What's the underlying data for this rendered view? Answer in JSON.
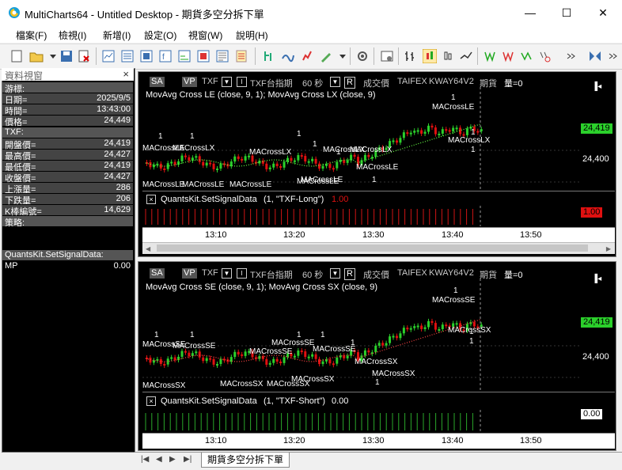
{
  "window": {
    "title": "MultiCharts64 - Untitled Desktop - 期貨多空分拆下單",
    "minimize": "—",
    "maximize": "☐",
    "close": "✕"
  },
  "menu": [
    "檔案(F)",
    "檢視(I)",
    "新增(I)",
    "設定(O)",
    "視窗(W)",
    "說明(H)"
  ],
  "data_window": {
    "title": "資料視窗",
    "close": "×",
    "rows": [
      {
        "label": "游標:",
        "value": ""
      },
      {
        "label": "日期=",
        "value": "2025/9/5"
      },
      {
        "label": "時間=",
        "value": "13:43:00"
      },
      {
        "label": "價格=",
        "value": "24,449"
      },
      {
        "label": "TXF:",
        "value": ""
      },
      {
        "label": "開盤價=",
        "value": "24,419"
      },
      {
        "label": "最高價=",
        "value": "24,427"
      },
      {
        "label": "最低價=",
        "value": "24,419"
      },
      {
        "label": "收盤價=",
        "value": "24,427"
      },
      {
        "label": "上漲量=",
        "value": "286"
      },
      {
        "label": "下跌量=",
        "value": "206"
      },
      {
        "label": "K棒編號=",
        "value": "14,629"
      },
      {
        "label": "策略:",
        "value": ""
      }
    ],
    "section2_title": "QuantsKit.SetSignalData:",
    "section2_rows": [
      {
        "label": "MP",
        "value": "0.00"
      }
    ]
  },
  "chart1": {
    "header": {
      "sa": "SA",
      "vp": "VP",
      "symbol": "TXF",
      "ticker_desc": "TXF台指期",
      "interval": "60 秒",
      "r_btn": "R",
      "mode": "成交價",
      "exchange": "TAIFEX",
      "feed": "KWAY64V2",
      "type": "期貨",
      "volume": "量=0"
    },
    "strategy_line": "MovAvg Cross LE (close,  9,  1); MovAvg Cross LX (close,  9)",
    "price_last": "24,419",
    "price_level": "24,400",
    "indicator_label": "QuantsKit.SetSignalData",
    "indicator_params": "(1,  \"TXF-Long\")",
    "indicator_value": "1.00",
    "indicator_tag": "1.00",
    "signals": [
      {
        "label": "MACrossLE",
        "count": "1"
      },
      {
        "label": "MACrossLX",
        "count": "1"
      }
    ],
    "signal_texts": [
      "1",
      "MACrossLE",
      "1",
      "MACrossLX",
      "1",
      "MACrossLX",
      "1",
      "MACrossLX",
      "1",
      "MACrossLX",
      "MACrossLE",
      "MACrossLE",
      "MACrossLE",
      "MACrossLE",
      "1",
      "MACrossLE",
      "1",
      "MACrossLX",
      "1",
      "MACrossLE",
      "1",
      "MACrossLE"
    ]
  },
  "chart2": {
    "header": {
      "sa": "SA",
      "vp": "VP",
      "symbol": "TXF",
      "ticker_desc": "TXF台指期",
      "interval": "60 秒",
      "r_btn": "R",
      "mode": "成交價",
      "exchange": "TAIFEX",
      "feed": "KWAY64V2",
      "type": "期貨",
      "volume": "量=0"
    },
    "strategy_line": "MovAvg Cross SE (close,  9,  1); MovAvg Cross SX (close,  9)",
    "price_last": "24,419",
    "price_level": "24,400",
    "indicator_label": "QuantsKit.SetSignalData",
    "indicator_params": "(1,  \"TXF-Short\")",
    "indicator_value": "0.00",
    "indicator_tag": "0.00",
    "signal_texts": [
      "1",
      "MACrossSE",
      "1",
      "MACrossSE",
      "1",
      "MACrossSE",
      "1",
      "MACrossSE",
      "1",
      "MACrossSE",
      "MACrossSX",
      "MACrossSX",
      "MACrossSX",
      "MACrossSX",
      "MACrossSX",
      "1",
      "MACrossSE",
      "1",
      "MACrossSX",
      "1",
      "MACrossSX",
      "1"
    ]
  },
  "time_axis": [
    "13:10",
    "13:20",
    "13:30",
    "13:40",
    "13:50"
  ],
  "bottom_tab": "期貨多空分拆下單",
  "colors": {
    "up": "#2bd02b",
    "down": "#e01010",
    "signal": "#2020ff",
    "bg": "#000000"
  }
}
